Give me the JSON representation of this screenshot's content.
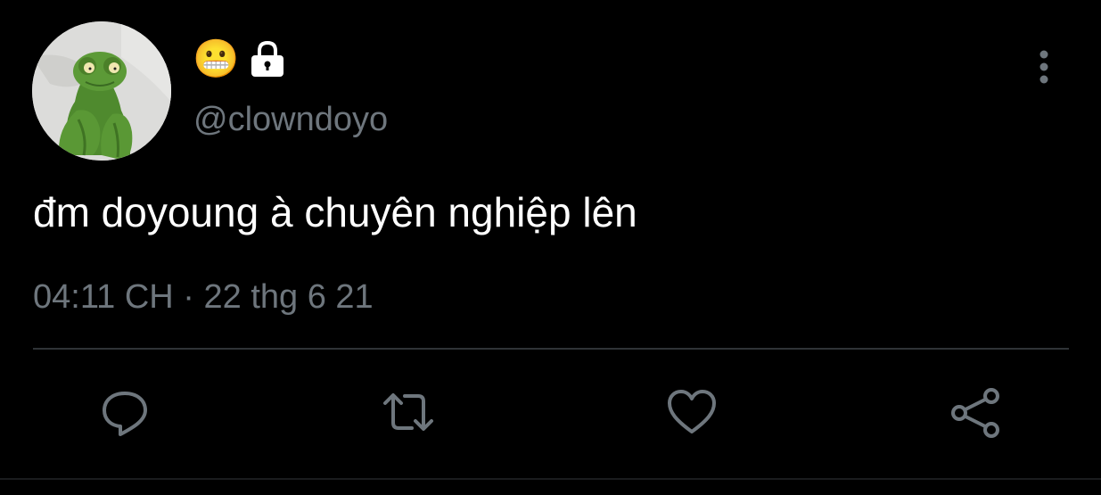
{
  "tweet": {
    "display_name_emoji": "😬",
    "lock_icon": "lock-icon",
    "handle": "@clowndoyo",
    "text": "đm doyoung à chuyên nghiệp lên",
    "time": "04:11 CH",
    "separator": "·",
    "date": "22 thg 6 21"
  },
  "actions": [
    {
      "icon": "reply-icon"
    },
    {
      "icon": "retweet-icon"
    },
    {
      "icon": "like-icon"
    },
    {
      "icon": "share-icon"
    }
  ],
  "colors": {
    "background": "#000000",
    "text_primary": "#ffffff",
    "text_secondary": "#6e767d",
    "divider": "#2f3336",
    "icon": "#6e767d"
  }
}
